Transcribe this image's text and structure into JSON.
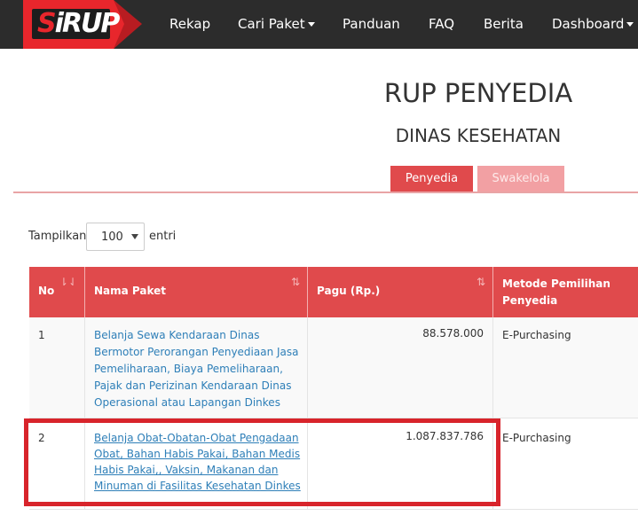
{
  "navbar": {
    "logo": "SiRUP",
    "items": [
      {
        "label": "Rekap",
        "dropdown": false
      },
      {
        "label": "Cari Paket",
        "dropdown": true
      },
      {
        "label": "Panduan",
        "dropdown": false
      },
      {
        "label": "FAQ",
        "dropdown": false
      },
      {
        "label": "Berita",
        "dropdown": false
      },
      {
        "label": "Dashboard",
        "dropdown": true
      }
    ]
  },
  "page": {
    "title": "RUP PENYEDIA",
    "subtitle": "DINAS KESEHATAN"
  },
  "tabs": [
    {
      "label": "Penyedia",
      "active": true
    },
    {
      "label": "Swakelola",
      "active": false
    }
  ],
  "length_selector": {
    "prefix": "Tampilkan",
    "value": "100",
    "suffix": "entri"
  },
  "table": {
    "columns": [
      "No",
      "Nama Paket",
      "Pagu (Rp.)",
      "Metode Pemilihan Penyedia"
    ],
    "rows": [
      {
        "no": "1",
        "nama_lines": [
          "Belanja Sewa Kendaraan Dinas",
          "Bermotor Perorangan Penyediaan Jasa",
          "Pemeliharaan, Biaya Pemeliharaan,",
          "Pajak dan Perizinan Kendaraan Dinas",
          "Operasional atau Lapangan Dinkes"
        ],
        "pagu": "88.578.000",
        "metode": "E-Purchasing"
      },
      {
        "no": "2",
        "nama_lines": [
          "Belanja Obat-Obatan-Obat Pengadaan",
          "Obat, Bahan Habis Pakai, Bahan Medis",
          "Habis Pakai,, Vaksin, Makanan dan",
          "Minuman di Fasilitas Kesehatan Dinkes"
        ],
        "pagu": "1.087.837.786",
        "metode": "E-Purchasing"
      }
    ]
  },
  "colors": {
    "navbar_bg": "#2c2c2c",
    "accent": "#e04a4c",
    "tab_inactive": "#f2a0a3",
    "link": "#2e7fb8",
    "highlight": "#d8242b"
  }
}
